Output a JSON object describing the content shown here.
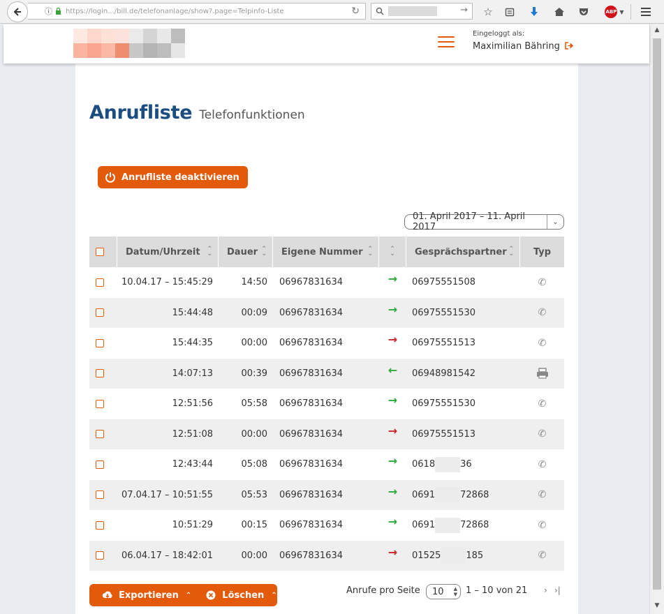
{
  "browser": {
    "url": "https://login.../bill.de/telefonanlage/show?.page=Telpinfo-Liste",
    "search_placeholder": "",
    "icons": [
      "back-icon",
      "info-icon",
      "lock-icon",
      "reload-icon",
      "search-icon",
      "star-icon",
      "reading-list-icon",
      "download-icon",
      "home-icon",
      "pocket-icon",
      "abp-icon",
      "menu-icon"
    ],
    "abp_label": "ABP"
  },
  "header": {
    "logged_in_label": "Eingeloggt als:",
    "user_name": "Maximilian Bähring",
    "accent": "#e35a0a"
  },
  "page": {
    "title": "Anrufliste",
    "subtitle": "Telefonfunktionen",
    "title_color": "#1b4d81",
    "deactivate_label": "Anrufliste deaktivieren",
    "date_range": "01. April 2017 – 11. April 2017"
  },
  "table": {
    "headers": {
      "datetime": "Datum/Uhrzeit",
      "duration": "Dauer",
      "own_number": "Eigene Nummer",
      "direction": "",
      "partner": "Gesprächspartner",
      "type": "Typ"
    },
    "rows": [
      {
        "datetime": "10.04.17 – 15:45:29",
        "duration": "14:50",
        "own": "06967831634",
        "dir": "out-ok",
        "partner_a": "06975551508",
        "partner_b": "",
        "type": "phone"
      },
      {
        "datetime": "15:44:48",
        "duration": "00:09",
        "own": "06967831634",
        "dir": "out-ok",
        "partner_a": "06975551530",
        "partner_b": "",
        "type": "phone"
      },
      {
        "datetime": "15:44:35",
        "duration": "00:00",
        "own": "06967831634",
        "dir": "out-miss",
        "partner_a": "06975551513",
        "partner_b": "",
        "type": "phone"
      },
      {
        "datetime": "14:07:13",
        "duration": "00:39",
        "own": "06967831634",
        "dir": "in",
        "partner_a": "06948981542",
        "partner_b": "",
        "type": "fax"
      },
      {
        "datetime": "12:51:56",
        "duration": "05:58",
        "own": "06967831634",
        "dir": "out-ok",
        "partner_a": "06975551530",
        "partner_b": "",
        "type": "phone"
      },
      {
        "datetime": "12:51:08",
        "duration": "00:00",
        "own": "06967831634",
        "dir": "out-miss",
        "partner_a": "06975551513",
        "partner_b": "",
        "type": "phone"
      },
      {
        "datetime": "12:43:44",
        "duration": "05:08",
        "own": "06967831634",
        "dir": "out-ok",
        "partner_a": "0618",
        "partner_b": "36",
        "type": "phone"
      },
      {
        "datetime": "07.04.17 – 10:51:55",
        "duration": "05:53",
        "own": "06967831634",
        "dir": "out-ok",
        "partner_a": "0691",
        "partner_b": "72868",
        "type": "phone"
      },
      {
        "datetime": "10:51:29",
        "duration": "00:15",
        "own": "06967831634",
        "dir": "out-ok",
        "partner_a": "0691",
        "partner_b": "72868",
        "type": "phone"
      },
      {
        "datetime": "06.04.17 – 18:42:01",
        "duration": "00:00",
        "own": "06967831634",
        "dir": "out-miss",
        "partner_a": "01525",
        "partner_b": "185",
        "type": "phone"
      }
    ]
  },
  "footer": {
    "export_label": "Exportieren",
    "delete_label": "Löschen",
    "per_page_label": "Anrufe pro Seite",
    "per_page_value": "10",
    "range_text": "1 – 10 von 21",
    "next_symbol": "›",
    "last_symbol": "›|"
  }
}
